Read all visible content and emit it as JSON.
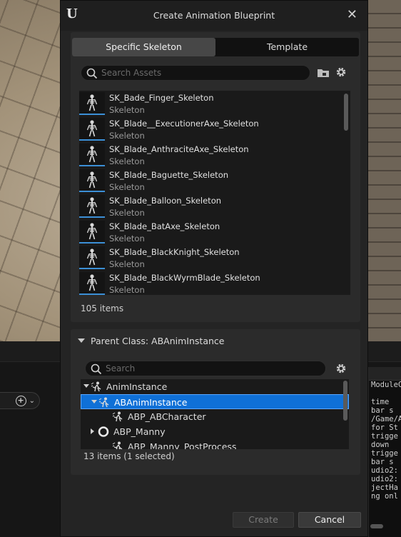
{
  "dialog": {
    "title": "Create Animation Blueprint",
    "close_glyph": "✕",
    "logo_glyph": "U"
  },
  "tabs": [
    {
      "label": "Specific Skeleton",
      "active": true
    },
    {
      "label": "Template",
      "active": false
    }
  ],
  "asset_search": {
    "placeholder": "Search Assets"
  },
  "assets": [
    {
      "name": "SK_Bade_Finger_Skeleton",
      "type": "Skeleton"
    },
    {
      "name": "SK_Blade__ExecutionerAxe_Skeleton",
      "type": "Skeleton"
    },
    {
      "name": "SK_Blade_AnthraciteAxe_Skeleton",
      "type": "Skeleton"
    },
    {
      "name": "SK_Blade_Baguette_Skeleton",
      "type": "Skeleton"
    },
    {
      "name": "SK_Blade_Balloon_Skeleton",
      "type": "Skeleton"
    },
    {
      "name": "SK_Blade_BatAxe_Skeleton",
      "type": "Skeleton"
    },
    {
      "name": "SK_Blade_BlackKnight_Skeleton",
      "type": "Skeleton"
    },
    {
      "name": "SK_Blade_BlackWyrmBlade_Skeleton",
      "type": "Skeleton"
    }
  ],
  "asset_count": "105 items",
  "parent_class": {
    "header": "Parent Class: ABAnimInstance",
    "search_placeholder": "Search",
    "rows": [
      {
        "label": "AnimInstance",
        "expander": "down",
        "icon": "anim-class-icon"
      },
      {
        "label": "ABAnimInstance",
        "expander": "down",
        "icon": "anim-class-icon",
        "selected": true
      },
      {
        "label": "ABP_ABCharacter",
        "expander": "none",
        "icon": "anim-class-icon"
      },
      {
        "label": "ABP_Manny",
        "expander": "right",
        "icon": "anim-blueprint-icon"
      },
      {
        "label": "ABP_Manny_PostProcess",
        "expander": "none",
        "icon": "anim-class-icon"
      }
    ],
    "count": "13 items (1 selected)"
  },
  "buttons": {
    "create": "Create",
    "cancel": "Cancel"
  },
  "background": {
    "log_lines": [
      "ModuleCo",
      "",
      " time",
      " bar s",
      "/Game/A",
      "for St",
      "trigge",
      " down",
      "trigge",
      " bar s",
      "udio2:",
      "udio2:",
      "jectHa",
      "ng onl"
    ]
  },
  "colors": {
    "accent": "#3b8fd6",
    "selection": "#0f70d7"
  }
}
